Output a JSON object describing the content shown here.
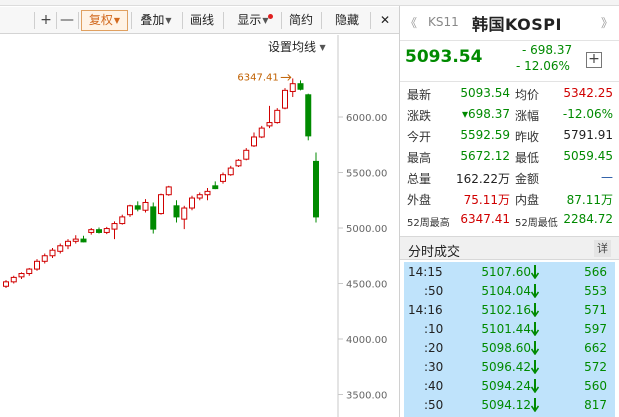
{
  "toolbar": {
    "tool_a_label": "",
    "zoom_in": "+",
    "zoom_out": "—",
    "adjust_label": "复权",
    "overlay_label": "叠加",
    "draw_label": "画线",
    "display_label": "显示",
    "simple_label": "简约",
    "hide_label": "隐藏",
    "close_label": "✕"
  },
  "chart": {
    "ma_setting_label": "设置均线",
    "peak_label": "6347.41",
    "colors": {
      "up": "#d00000",
      "down": "#008a00",
      "peak": "#c06000"
    }
  },
  "chart_data": {
    "type": "candlestick",
    "y_ticks": [
      "6000.00",
      "5500.00",
      "5000.00",
      "4500.00",
      "4000.00",
      "3500.00"
    ],
    "ylim": [
      3500,
      6350
    ],
    "candles": [
      {
        "o": 4475,
        "h": 4530,
        "l": 4460,
        "c": 4515
      },
      {
        "o": 4515,
        "h": 4570,
        "l": 4500,
        "c": 4555
      },
      {
        "o": 4560,
        "h": 4600,
        "l": 4540,
        "c": 4590
      },
      {
        "o": 4590,
        "h": 4640,
        "l": 4570,
        "c": 4630
      },
      {
        "o": 4630,
        "h": 4720,
        "l": 4615,
        "c": 4700
      },
      {
        "o": 4700,
        "h": 4770,
        "l": 4680,
        "c": 4750
      },
      {
        "o": 4750,
        "h": 4820,
        "l": 4730,
        "c": 4800
      },
      {
        "o": 4790,
        "h": 4860,
        "l": 4770,
        "c": 4840
      },
      {
        "o": 4840,
        "h": 4900,
        "l": 4810,
        "c": 4880
      },
      {
        "o": 4880,
        "h": 4935,
        "l": 4860,
        "c": 4900
      },
      {
        "o": 4900,
        "h": 4930,
        "l": 4870,
        "c": 4875
      },
      {
        "o": 4960,
        "h": 5000,
        "l": 4940,
        "c": 4985
      },
      {
        "o": 4985,
        "h": 5005,
        "l": 4950,
        "c": 4960
      },
      {
        "o": 4960,
        "h": 5010,
        "l": 4945,
        "c": 4995
      },
      {
        "o": 4990,
        "h": 5060,
        "l": 4900,
        "c": 5040
      },
      {
        "o": 5040,
        "h": 5120,
        "l": 5030,
        "c": 5100
      },
      {
        "o": 5120,
        "h": 5210,
        "l": 5100,
        "c": 5200
      },
      {
        "o": 5200,
        "h": 5240,
        "l": 5150,
        "c": 5170
      },
      {
        "o": 5160,
        "h": 5260,
        "l": 5140,
        "c": 5230
      },
      {
        "o": 5190,
        "h": 5230,
        "l": 4950,
        "c": 4990
      },
      {
        "o": 5130,
        "h": 5310,
        "l": 5120,
        "c": 5300
      },
      {
        "o": 5300,
        "h": 5380,
        "l": 5290,
        "c": 5370
      },
      {
        "o": 5200,
        "h": 5250,
        "l": 5050,
        "c": 5100
      },
      {
        "o": 5080,
        "h": 5200,
        "l": 4990,
        "c": 5180
      },
      {
        "o": 5180,
        "h": 5290,
        "l": 5160,
        "c": 5270
      },
      {
        "o": 5270,
        "h": 5320,
        "l": 5250,
        "c": 5300
      },
      {
        "o": 5300,
        "h": 5360,
        "l": 5250,
        "c": 5330
      },
      {
        "o": 5380,
        "h": 5420,
        "l": 5350,
        "c": 5355
      },
      {
        "o": 5420,
        "h": 5500,
        "l": 5400,
        "c": 5480
      },
      {
        "o": 5480,
        "h": 5560,
        "l": 5470,
        "c": 5540
      },
      {
        "o": 5560,
        "h": 5620,
        "l": 5550,
        "c": 5610
      },
      {
        "o": 5620,
        "h": 5720,
        "l": 5610,
        "c": 5700
      },
      {
        "o": 5740,
        "h": 5860,
        "l": 5730,
        "c": 5820
      },
      {
        "o": 5820,
        "h": 5920,
        "l": 5810,
        "c": 5900
      },
      {
        "o": 5920,
        "h": 6100,
        "l": 5900,
        "c": 5950
      },
      {
        "o": 5950,
        "h": 6080,
        "l": 5940,
        "c": 6060
      },
      {
        "o": 6080,
        "h": 6260,
        "l": 6070,
        "c": 6240
      },
      {
        "o": 6230,
        "h": 6347.41,
        "l": 6180,
        "c": 6300
      },
      {
        "o": 6300,
        "h": 6330,
        "l": 6240,
        "c": 6250
      },
      {
        "o": 6200,
        "h": 6210,
        "l": 5790,
        "c": 5830
      },
      {
        "o": 5600,
        "h": 5680,
        "l": 5050,
        "c": 5100
      }
    ]
  },
  "quote": {
    "code": "KS11",
    "name": "韩国KOSPI",
    "nav_left": "《",
    "nav_right": "》",
    "price": "5093.54",
    "change": "- 698.37",
    "change_pct": "- 12.06%",
    "add_label": "+",
    "colors": {
      "down": "#008a00",
      "up": "#d00000"
    },
    "stats": [
      {
        "l1": "最新",
        "v1": "5093.54",
        "c1": "green",
        "l2": "均价",
        "v2": "5342.25",
        "c2": "red"
      },
      {
        "l1": "涨跌",
        "v1": "▾698.37",
        "c1": "green",
        "l2": "涨幅",
        "v2": "-12.06%",
        "c2": "green"
      },
      {
        "l1": "今开",
        "v1": "5592.59",
        "c1": "green",
        "l2": "昨收",
        "v2": "5791.91",
        "c2": "blk"
      },
      {
        "l1": "最高",
        "v1": "5672.12",
        "c1": "green",
        "l2": "最低",
        "v2": "5059.45",
        "c2": "green"
      },
      {
        "l1": "总量",
        "v1": "162.22万",
        "c1": "blk",
        "l2": "金额",
        "v2": "—",
        "c2": "blue"
      },
      {
        "l1": "外盘",
        "v1": "75.11万",
        "c1": "red",
        "l2": "内盘",
        "v2": "87.11万",
        "c2": "green"
      },
      {
        "l1": "52周最高",
        "v1": "6347.41",
        "c1": "red",
        "l2": "52周最低",
        "v2": "2284.72",
        "c2": "green",
        "small": true
      }
    ],
    "ticks_title": "分时成交",
    "ticks_detail": "详",
    "ticks": [
      {
        "time": "14:15",
        "price": "5107.60",
        "vol": "566",
        "sub": false
      },
      {
        "time": ":50",
        "price": "5104.04",
        "vol": "553",
        "sub": true
      },
      {
        "time": "14:16",
        "price": "5102.16",
        "vol": "571",
        "sub": false
      },
      {
        "time": ":10",
        "price": "5101.44",
        "vol": "597",
        "sub": true
      },
      {
        "time": ":20",
        "price": "5098.60",
        "vol": "662",
        "sub": true
      },
      {
        "time": ":30",
        "price": "5096.42",
        "vol": "572",
        "sub": true
      },
      {
        "time": ":40",
        "price": "5094.24",
        "vol": "560",
        "sub": true
      },
      {
        "time": ":50",
        "price": "5094.12",
        "vol": "817",
        "sub": true
      }
    ]
  }
}
